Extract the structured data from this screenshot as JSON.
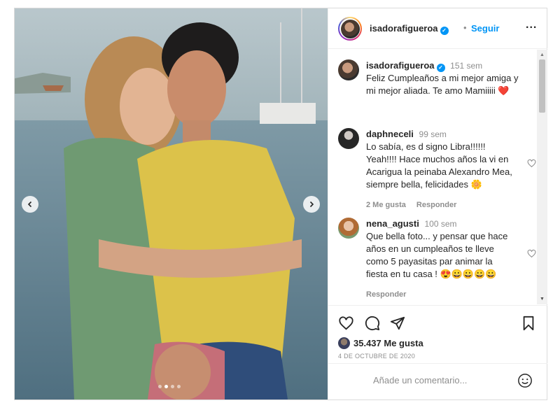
{
  "post": {
    "author": {
      "username": "isadorafigueroa",
      "verified": true,
      "follow_label": "Seguir",
      "separator": "•",
      "more_label": "..."
    },
    "caption": {
      "username": "isadorafigueroa",
      "time": "151 sem",
      "text": "Feliz Cumpleaños a mi mejor amiga y mi mejor aliada. Te amo Mamiiiii ❤️"
    },
    "carousel": {
      "slides": 4,
      "active_index": 1
    },
    "comments": [
      {
        "username": "daphneceli",
        "time": "99 sem",
        "text": "Lo sabía, es d signo Libra!!!!!! Yeah!!!! Hace muchos años la vi en Acarigua la peinaba Alexandro Mea, siempre bella, felicidades 🌼",
        "likes": "2 Me gusta",
        "reply_label": "Responder"
      },
      {
        "username": "nena_agusti",
        "time": "100 sem",
        "text": "Que bella foto... y pensar que hace años en un cumpleaños te lleve como 5 payasitas par animar la fiesta en tu casa ! 😍😀😀😀😀",
        "reply_label": "Responder"
      }
    ],
    "likes_count": "35.437 Me gusta",
    "date": "4 DE OCTUBRE DE 2020",
    "comment_placeholder": "Añade un comentario..."
  },
  "colors": {
    "accent": "#0095f6",
    "text": "#262626",
    "secondary": "#8e8e8e",
    "border": "#dbdbdb",
    "heart": "#ed4956"
  },
  "icons": {
    "nav_prev": "chevron-left-icon",
    "nav_next": "chevron-right-icon",
    "like": "heart-icon",
    "comment": "comment-icon",
    "share": "paper-plane-icon",
    "save": "bookmark-icon",
    "emoji": "smiley-icon"
  }
}
